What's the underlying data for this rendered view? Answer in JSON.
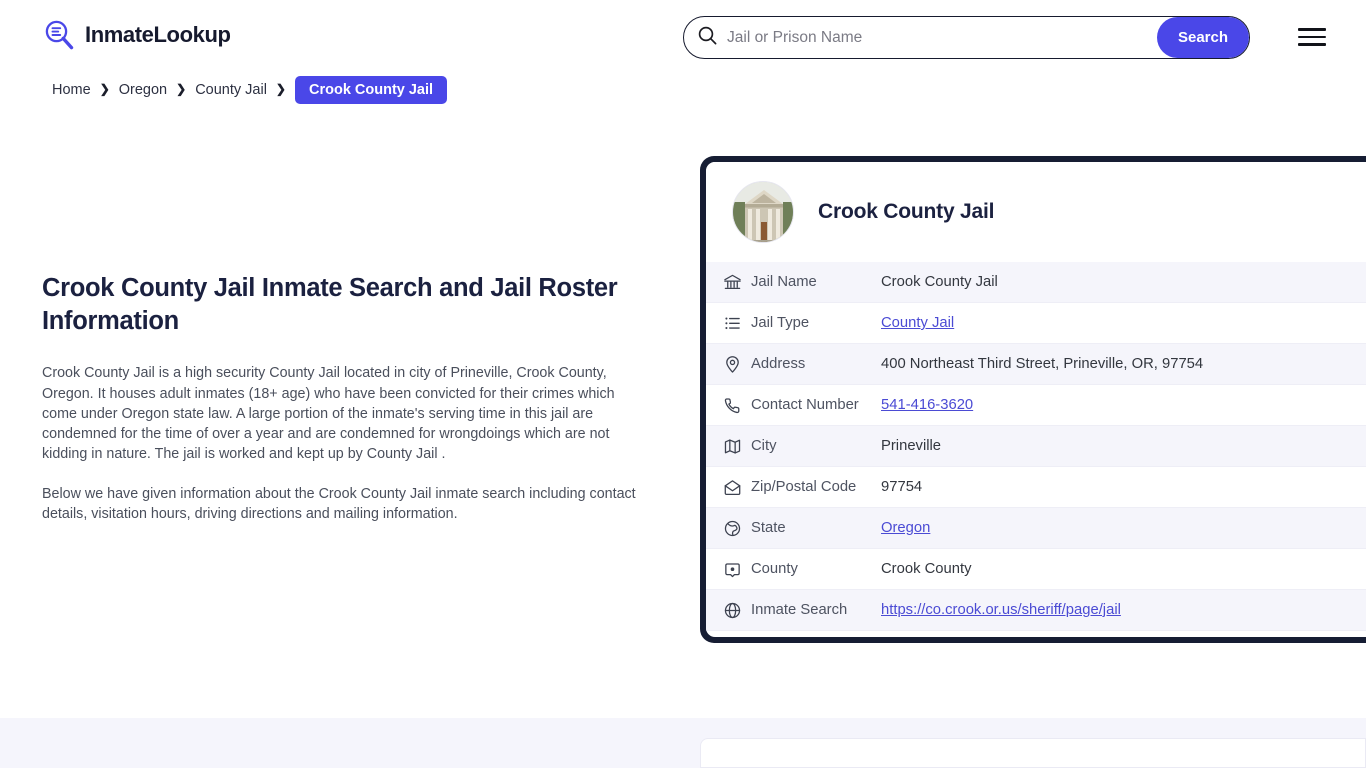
{
  "header": {
    "brand_name": "InmateLookup",
    "brand_icon": "magnifier-list-logo",
    "menu_icon": "hamburger-menu-icon"
  },
  "search": {
    "placeholder": "Jail or Prison Name",
    "value": "",
    "button_label": "Search",
    "icon": "search-icon",
    "accent_color": "#4a47e8"
  },
  "breadcrumb": {
    "separator": "❯",
    "items": [
      {
        "label": "Home",
        "current": false
      },
      {
        "label": "Oregon",
        "current": false
      },
      {
        "label": "County Jail",
        "current": false
      },
      {
        "label": "Crook County Jail",
        "current": true
      }
    ]
  },
  "main": {
    "title": "Crook County Jail Inmate Search and Jail Roster Information",
    "paragraphs": [
      "Crook County Jail is a high security County Jail located in city of Prineville, Crook County, Oregon. It houses adult inmates (18+ age) who have been convicted for their crimes which come under Oregon state law. A large portion of the inmate's serving time in this jail are condemned for the time of over a year and are condemned for wrongdoings which are not kidding in nature. The jail is worked and kept up by County Jail .",
      "Below we have given information about the Crook County Jail inmate search including contact details, visitation hours, driving directions and mailing information."
    ]
  },
  "card": {
    "title": "Crook County Jail",
    "avatar_icon": "courthouse-photo",
    "border_color": "#161d33",
    "rows": [
      {
        "icon": "bank-icon",
        "label": "Jail Name",
        "value": "Crook County Jail",
        "link": false
      },
      {
        "icon": "list-icon",
        "label": "Jail Type",
        "value": "County Jail",
        "link": true
      },
      {
        "icon": "map-pin-icon",
        "label": "Address",
        "value": "400 Northeast Third Street, Prineville, OR, 97754",
        "link": false
      },
      {
        "icon": "phone-icon",
        "label": "Contact Number",
        "value": "541-416-3620",
        "link": true
      },
      {
        "icon": "map-icon",
        "label": "City",
        "value": "Prineville",
        "link": false
      },
      {
        "icon": "envelope-icon",
        "label": "Zip/Postal Code",
        "value": "97754",
        "link": false
      },
      {
        "icon": "globe-pin-icon",
        "label": "State",
        "value": "Oregon",
        "link": true
      },
      {
        "icon": "county-icon",
        "label": "County",
        "value": "Crook County",
        "link": false
      },
      {
        "icon": "globe-icon",
        "label": "Inmate Search",
        "value": "https://co.crook.or.us/sheriff/page/jail",
        "link": true
      }
    ]
  }
}
